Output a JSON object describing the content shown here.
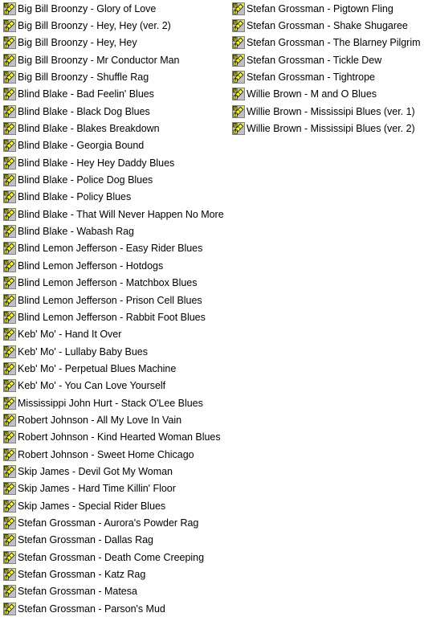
{
  "window": {
    "view_mode": "list",
    "background_color": "#ffffff",
    "text_color": "#000000",
    "icon": {
      "name": "text-script-file-icon",
      "frame_color": "#808080",
      "face_color": "#c0c0c0",
      "glyph_color": "#ffff00",
      "outline_color": "#000000"
    }
  },
  "columns": [
    {
      "name": "column-left",
      "items": [
        {
          "label": "Big Bill Broonzy - Glory of Love"
        },
        {
          "label": "Big Bill Broonzy - Hey, Hey (ver. 2)"
        },
        {
          "label": "Big Bill Broonzy - Hey, Hey"
        },
        {
          "label": "Big Bill Broonzy - Mr Conductor Man"
        },
        {
          "label": "Big Bill Broonzy - Shuffle Rag"
        },
        {
          "label": "Blind Blake - Bad Feelin' Blues"
        },
        {
          "label": "Blind Blake - Black Dog Blues"
        },
        {
          "label": "Blind Blake - Blakes Breakdown"
        },
        {
          "label": "Blind Blake - Georgia Bound"
        },
        {
          "label": "Blind Blake - Hey Hey Daddy Blues"
        },
        {
          "label": "Blind Blake - Police Dog Blues"
        },
        {
          "label": "Blind Blake - Policy Blues"
        },
        {
          "label": "Blind Blake - That Will Never Happen No More"
        },
        {
          "label": "Blind Blake - Wabash Rag"
        },
        {
          "label": "Blind Lemon Jefferson - Easy Rider Blues"
        },
        {
          "label": "Blind Lemon Jefferson - Hotdogs"
        },
        {
          "label": "Blind Lemon Jefferson - Matchbox Blues"
        },
        {
          "label": "Blind Lemon Jefferson - Prison Cell Blues"
        },
        {
          "label": "Blind Lemon Jefferson - Rabbit Foot Blues"
        },
        {
          "label": "Keb' Mo' - Hand It Over"
        },
        {
          "label": "Keb' Mo' - Lullaby Baby Bues"
        },
        {
          "label": "Keb' Mo' - Perpetual Blues Machine"
        },
        {
          "label": "Keb' Mo' - You Can Love Yourself"
        },
        {
          "label": "Mississippi John Hurt - Stack O'Lee Blues"
        },
        {
          "label": "Robert Johnson - All My Love In Vain"
        },
        {
          "label": "Robert Johnson - Kind Hearted Woman Blues"
        },
        {
          "label": "Robert Johnson - Sweet Home Chicago"
        },
        {
          "label": "Skip James - Devil Got My Woman"
        },
        {
          "label": "Skip James - Hard Time Killin' Floor"
        },
        {
          "label": "Skip James - Special Rider Blues"
        },
        {
          "label": "Stefan Grossman - Aurora's Powder Rag"
        },
        {
          "label": "Stefan Grossman - Dallas Rag"
        },
        {
          "label": "Stefan Grossman - Death Come Creeping"
        },
        {
          "label": "Stefan Grossman - Katz Rag"
        },
        {
          "label": "Stefan Grossman - Matesa"
        },
        {
          "label": "Stefan Grossman - Parson's Mud"
        }
      ]
    },
    {
      "name": "column-right",
      "items": [
        {
          "label": "Stefan Grossman - Pigtown Fling"
        },
        {
          "label": "Stefan Grossman - Shake Shugaree"
        },
        {
          "label": "Stefan Grossman - The Blarney Pilgrim"
        },
        {
          "label": "Stefan Grossman - Tickle Dew"
        },
        {
          "label": "Stefan Grossman - Tightrope"
        },
        {
          "label": "Willie Brown - M and O Blues"
        },
        {
          "label": "Willie Brown - Mississipi Blues (ver. 1)"
        },
        {
          "label": "Willie Brown - Mississipi Blues (ver. 2)"
        }
      ]
    }
  ]
}
